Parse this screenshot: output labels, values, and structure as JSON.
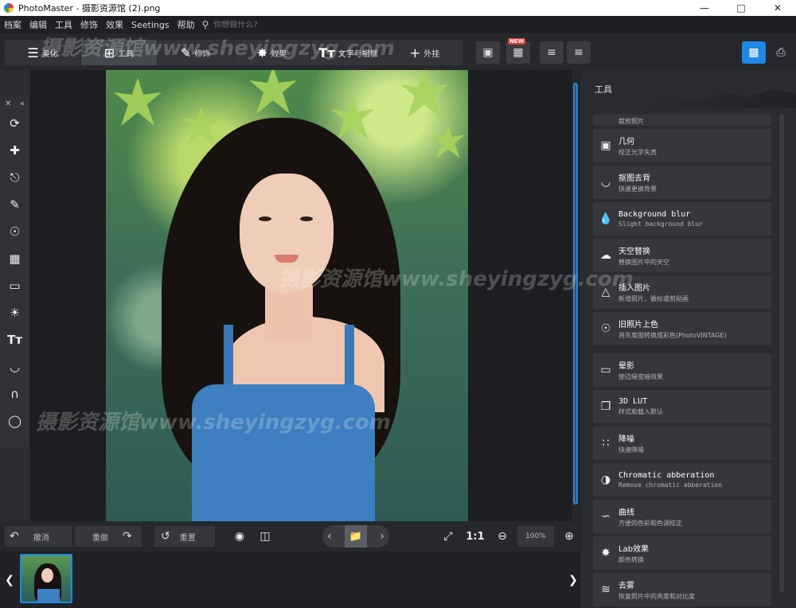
{
  "window": {
    "title": "PhotoMaster - 摄影资源馆 (2).png"
  },
  "menu": [
    "档案",
    "编辑",
    "工具",
    "修饰",
    "效果",
    "Seetings",
    "帮助"
  ],
  "search": {
    "placeholder": "你想做什么?"
  },
  "tabs": [
    {
      "label": "美化",
      "icon": "sliders-icon"
    },
    {
      "label": "工具",
      "icon": "crop-icon"
    },
    {
      "label": "修饰",
      "icon": "brush-icon"
    },
    {
      "label": "效果",
      "icon": "magic-wand-icon"
    },
    {
      "label": "文字与相框",
      "icon": "text-icon"
    },
    {
      "label": "外挂",
      "icon": "plus-icon"
    }
  ],
  "toolbar_badge": "NEW",
  "panel": {
    "title": "工具",
    "partial_item": "裁剪照片",
    "items": [
      {
        "name": "几何",
        "desc": "校正光学失真"
      },
      {
        "name": "抠图去背",
        "desc": "快速更换背景"
      },
      {
        "name": "Background blur",
        "desc": "Slight background blur"
      },
      {
        "name": "天空替换",
        "desc": "替换图片中的天空"
      },
      {
        "name": "插入图片",
        "desc": "新增照片，徽标或剪贴画"
      },
      {
        "name": "旧照片上色",
        "desc": "将灰度图转换成彩色(PhotoVINTAGE)"
      }
    ],
    "items2": [
      {
        "name": "晕影",
        "desc": "使边缘变暗效果"
      },
      {
        "name": "3D LUT",
        "desc": "样式和载入默认"
      },
      {
        "name": "降噪",
        "desc": "快速降噪"
      },
      {
        "name": "Chromatic abberation",
        "desc": "Remove chromatic abberation"
      },
      {
        "name": "曲线",
        "desc": "方便的色彩和色调校正"
      },
      {
        "name": "Lab效果",
        "desc": "颜色转换"
      },
      {
        "name": "去雾",
        "desc": "恢复照片中的亮度和对比度"
      }
    ]
  },
  "bottom": {
    "undo": "撤消",
    "redo": "重做",
    "reset": "重置",
    "fit": "1:1",
    "zoom": "100%"
  },
  "watermark": "摄影资源馆www.sheyingzyg.com",
  "colors": {
    "accent": "#1e88e5",
    "badge": "#e53935"
  }
}
